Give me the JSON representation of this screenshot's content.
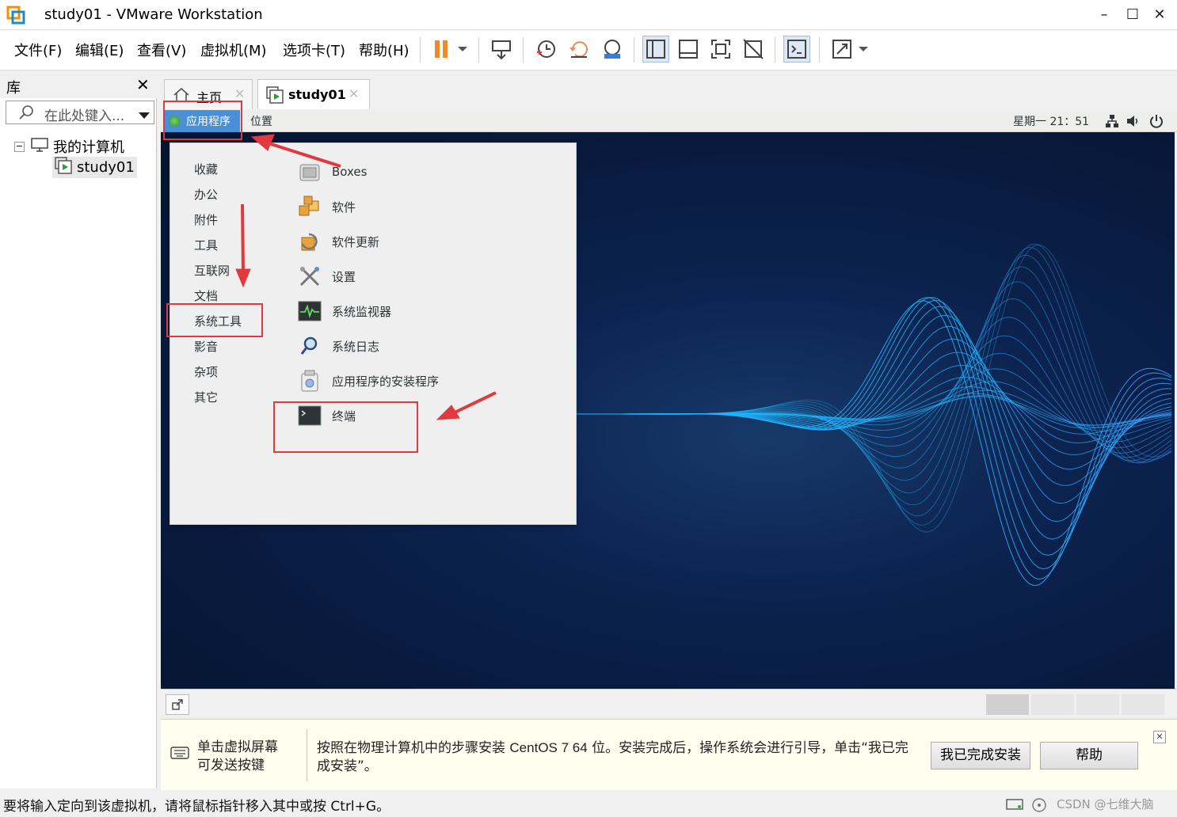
{
  "window": {
    "title": "study01 - VMware Workstation"
  },
  "menu": [
    {
      "label": "文件(F)"
    },
    {
      "label": "编辑(E)"
    },
    {
      "label": "查看(V)"
    },
    {
      "label": "虚拟机(M)"
    },
    {
      "label": "选项卡(T)"
    },
    {
      "label": "帮助(H)"
    }
  ],
  "toolbar": {
    "icons": [
      "pause-icon",
      "send-ctrl-alt-del-icon",
      "snapshot-icon",
      "revert-snapshot-icon",
      "snapshot-manager-icon",
      "library-view-icon",
      "thumbnail-bar-icon",
      "fullscreen-icon",
      "unity-icon",
      "console-view-icon",
      "stretch-guest-icon"
    ]
  },
  "library": {
    "title": "库",
    "search_placeholder": "在此处键入...",
    "tree": {
      "root": "我的计算机",
      "child": "study01"
    }
  },
  "tabs": [
    {
      "label": "主页"
    },
    {
      "label": "study01"
    }
  ],
  "gnome_bar": {
    "applications": "应用程序",
    "places": "位置",
    "clock": "星期一 21：51"
  },
  "app_menu": {
    "categories": [
      "收藏",
      "办公",
      "附件",
      "工具",
      "互联网",
      "文档",
      "系统工具",
      "影音",
      "杂项",
      "其它"
    ],
    "apps": [
      {
        "label": "Boxes",
        "icon": "boxes-icon"
      },
      {
        "label": "软件",
        "icon": "software-icon"
      },
      {
        "label": "软件更新",
        "icon": "software-update-icon"
      },
      {
        "label": "设置",
        "icon": "settings-icon"
      },
      {
        "label": "系统监视器",
        "icon": "system-monitor-icon"
      },
      {
        "label": "系统日志",
        "icon": "system-log-icon"
      },
      {
        "label": "应用程序的安装程序",
        "icon": "app-installer-icon"
      },
      {
        "label": "终端",
        "icon": "terminal-icon"
      }
    ],
    "selected_category": "系统工具"
  },
  "hint": {
    "left": "单击虚拟屏幕\n可发送按键",
    "message_pre": "按照在物理计算机中的步骤安装 ",
    "message_os": "CentOS 7 64",
    "message_post": " 位。安装完成后，操作系统会进行引导，单击“我已完成安装”。",
    "done_button": "我已完成安装",
    "help_button": "帮助"
  },
  "status": {
    "text": "要将输入定向到该虚拟机，请将鼠标指针移入其中或按 Ctrl+G。",
    "watermark": "CSDN @七维大脑"
  },
  "colors": {
    "accent_red": "#e0393e",
    "gnome_highlight": "#4a90d9",
    "wave": "#1fb6ff"
  }
}
